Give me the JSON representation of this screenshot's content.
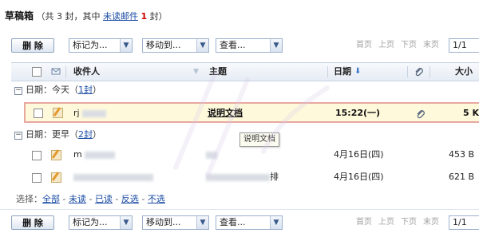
{
  "title": {
    "folder": "草稿箱",
    "prefix": "（共 3 封，其中",
    "unread_link": "未读邮件",
    "unread_count": "1",
    "suffix": "封）"
  },
  "toolbar": {
    "delete_label": "删 除",
    "mark_as": "标记为...",
    "move_to": "移动到...",
    "view": "查看...",
    "pager": {
      "first": "首页",
      "prev": "上页",
      "next": "下页",
      "last": "末页",
      "page": "1/1"
    }
  },
  "columns": {
    "recipient": "收件人",
    "subject": "主题",
    "date": "日期",
    "size": "大小"
  },
  "groups": [
    {
      "label_prefix": "日期：今天（",
      "count": "1封",
      "label_suffix": "）"
    },
    {
      "label_prefix": "日期：更早（",
      "count": "2封",
      "label_suffix": "）"
    }
  ],
  "mails": [
    {
      "recipient": "rj",
      "subject": "说明文档",
      "date": "15:22(一)",
      "size": "5 K"
    },
    {
      "recipient": "m",
      "subject": "",
      "date": "4月16日(四)",
      "size": "453 B"
    },
    {
      "recipient": "",
      "subject": "排",
      "date": "4月16日(四)",
      "size": "621 B"
    }
  ],
  "tooltip": "说明文档",
  "select_bar": {
    "label": "选择：",
    "all": "全部",
    "unread": "未读",
    "read": "已读",
    "invert": "反选",
    "none": "不选",
    "dash": " - "
  },
  "colors": {
    "link": "#1a4ba3",
    "unread_red": "#d00000",
    "selected_border": "#e8a8a0",
    "selected_bg": "#fff9dc"
  },
  "icons": {
    "sort": "arrow-down-icon",
    "attachment": "paperclip-icon",
    "draft": "pencil-icon"
  }
}
